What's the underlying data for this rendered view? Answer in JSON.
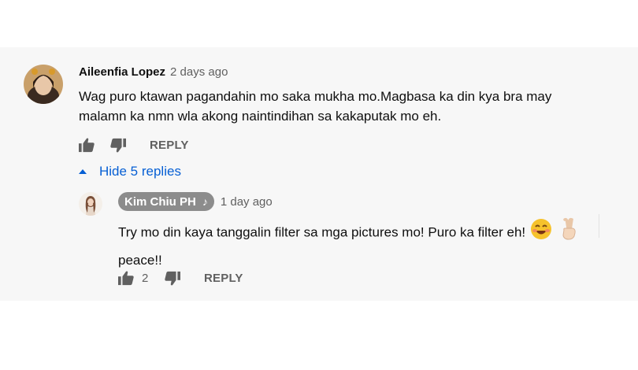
{
  "comment": {
    "author": "Aileenfia Lopez",
    "time": "2 days ago",
    "text_line1": "Wag puro ktawan pagandahin mo saka mukha mo.Magbasa ka din kya bra may",
    "text_line2": "malamn ka nmn wla akong naintindihan sa kakaputak mo eh.",
    "reply_label": "REPLY",
    "hide_replies_label": "Hide 5 replies"
  },
  "reply": {
    "author": "Kim Chiu PH",
    "author_badge": "♪",
    "time": "1 day ago",
    "text_line1": "Try mo din kaya tanggalin filter sa mga pictures mo! Puro ka filter eh!",
    "text_line2": "peace!!",
    "like_count": "2",
    "reply_label": "REPLY"
  },
  "icons": {
    "like": "thumbs-up-icon",
    "dislike": "thumbs-down-icon",
    "caret": "caret-up-icon",
    "music": "music-note-icon"
  },
  "colors": {
    "link_blue": "#065fd4",
    "panel_bg": "#f7f7f7",
    "chip_bg": "#8c8c8c"
  }
}
